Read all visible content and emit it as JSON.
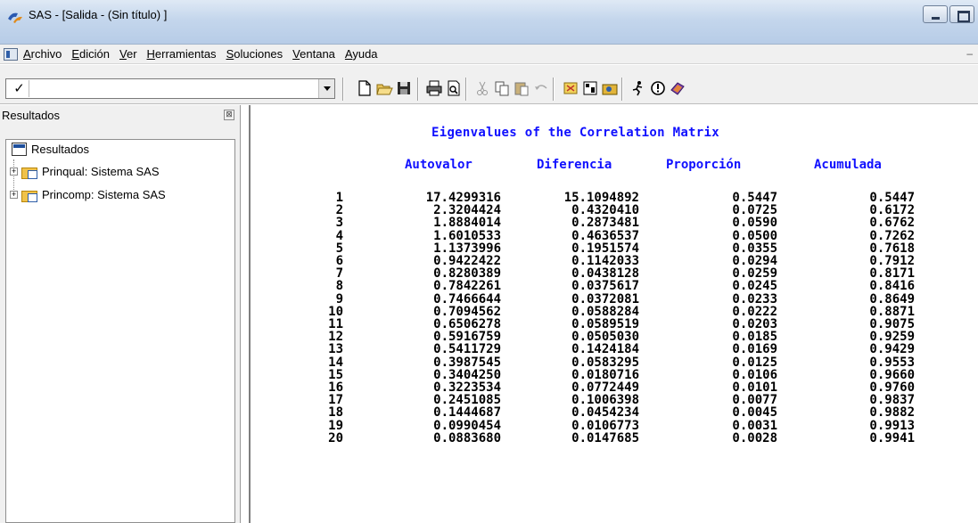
{
  "window": {
    "title": "SAS - [Salida - (Sin título) ]",
    "icon": "sas-app-icon"
  },
  "menubar": {
    "items": [
      "Archivo",
      "Edición",
      "Ver",
      "Herramientas",
      "Soluciones",
      "Ventana",
      "Ayuda"
    ]
  },
  "toolbar": {
    "command_value": "",
    "buttons": [
      "new-icon",
      "open-icon",
      "save-icon",
      "print-icon",
      "print-preview-icon",
      "cut-icon",
      "copy-icon",
      "paste-icon",
      "undo-icon",
      "explorer-icon",
      "results-icon",
      "library-icon",
      "submit-icon",
      "break-icon",
      "help-icon"
    ]
  },
  "results_panel": {
    "header": "Resultados",
    "root": "Resultados",
    "nodes": [
      "Prinqual:  Sistema SAS",
      "Princomp:  Sistema SAS"
    ]
  },
  "output": {
    "title": "Eigenvalues of the Correlation Matrix",
    "columns": [
      "Autovalor",
      "Diferencia",
      "Proporción",
      "Acumulada"
    ],
    "rows": [
      [
        "1",
        "17.4299316",
        "15.1094892",
        "0.5447",
        "0.5447"
      ],
      [
        "2",
        "2.3204424",
        "0.4320410",
        "0.0725",
        "0.6172"
      ],
      [
        "3",
        "1.8884014",
        "0.2873481",
        "0.0590",
        "0.6762"
      ],
      [
        "4",
        "1.6010533",
        "0.4636537",
        "0.0500",
        "0.7262"
      ],
      [
        "5",
        "1.1373996",
        "0.1951574",
        "0.0355",
        "0.7618"
      ],
      [
        "6",
        "0.9422422",
        "0.1142033",
        "0.0294",
        "0.7912"
      ],
      [
        "7",
        "0.8280389",
        "0.0438128",
        "0.0259",
        "0.8171"
      ],
      [
        "8",
        "0.7842261",
        "0.0375617",
        "0.0245",
        "0.8416"
      ],
      [
        "9",
        "0.7466644",
        "0.0372081",
        "0.0233",
        "0.8649"
      ],
      [
        "10",
        "0.7094562",
        "0.0588284",
        "0.0222",
        "0.8871"
      ],
      [
        "11",
        "0.6506278",
        "0.0589519",
        "0.0203",
        "0.9075"
      ],
      [
        "12",
        "0.5916759",
        "0.0505030",
        "0.0185",
        "0.9259"
      ],
      [
        "13",
        "0.5411729",
        "0.1424184",
        "0.0169",
        "0.9429"
      ],
      [
        "14",
        "0.3987545",
        "0.0583295",
        "0.0125",
        "0.9553"
      ],
      [
        "15",
        "0.3404250",
        "0.0180716",
        "0.0106",
        "0.9660"
      ],
      [
        "16",
        "0.3223534",
        "0.0772449",
        "0.0101",
        "0.9760"
      ],
      [
        "17",
        "0.2451085",
        "0.1006398",
        "0.0077",
        "0.9837"
      ],
      [
        "18",
        "0.1444687",
        "0.0454234",
        "0.0045",
        "0.9882"
      ],
      [
        "19",
        "0.0990454",
        "0.0106773",
        "0.0031",
        "0.9913"
      ],
      [
        "20",
        "0.0883680",
        "0.0147685",
        "0.0028",
        "0.9941"
      ]
    ]
  },
  "colors": {
    "title_text": "#1010ff",
    "body_text": "#000000",
    "titlebar": "#c4d6ec",
    "chrome": "#f0f0f0"
  }
}
